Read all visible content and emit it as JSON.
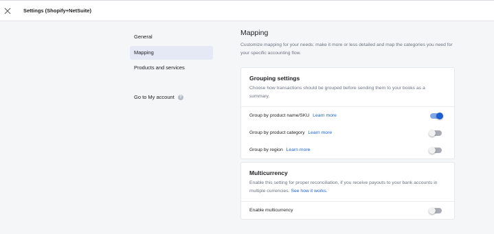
{
  "topbar": {
    "title": "Settings (Shopify+NetSuite)",
    "close_icon": "close-icon"
  },
  "nav": {
    "items": [
      {
        "label": "General",
        "active": false
      },
      {
        "label": "Mapping",
        "active": true
      },
      {
        "label": "Products and services",
        "active": false
      }
    ],
    "account_link": "Go to My account",
    "help_icon_glyph": "?"
  },
  "main": {
    "title": "Mapping",
    "description": "Customize mapping for your needs: make it more or less detailed and map the categories you need for your specific accounting flow."
  },
  "grouping": {
    "title": "Grouping settings",
    "description": "Choose how transactions should be grouped before sending them to your books as a summary.",
    "rows": [
      {
        "label": "Group by product name/SKU",
        "link": "Learn more",
        "enabled": true
      },
      {
        "label": "Group by product category",
        "link": "Learn more",
        "enabled": false
      },
      {
        "label": "Group by region",
        "link": "Learn more",
        "enabled": false
      }
    ]
  },
  "multicurrency": {
    "title": "Multicurrency",
    "description": "Enable this setting for proper reconciliation, if you receive payouts to your bank accounts in multiple currencies.",
    "link": "See how it works.",
    "row_label": "Enable multicurrency",
    "enabled": false
  },
  "colors": {
    "accent": "#1a5ed0",
    "link": "#1a62d6",
    "active_nav": "#e4e9f5"
  }
}
